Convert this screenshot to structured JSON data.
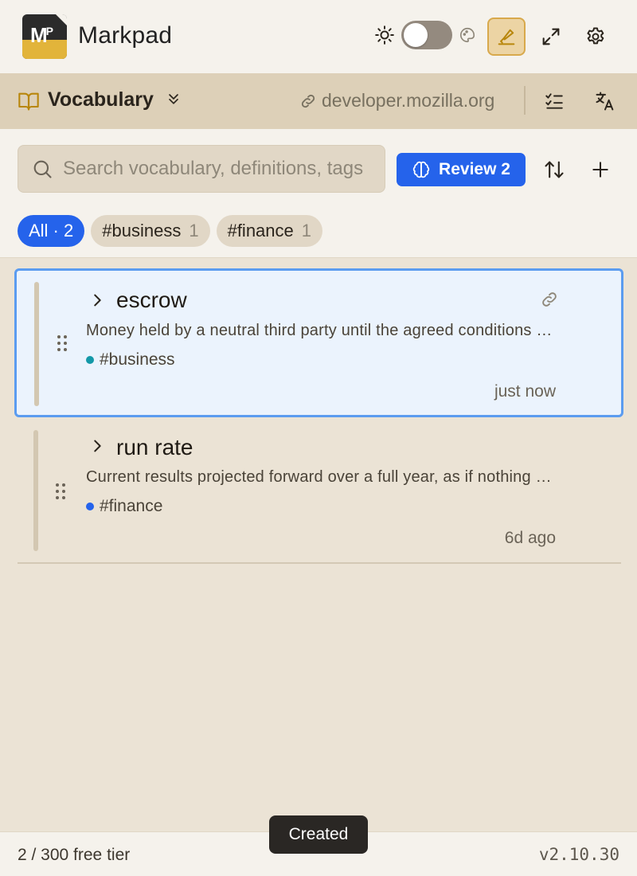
{
  "app": {
    "title": "Markpad",
    "logo_text": "MP"
  },
  "header": {
    "theme_toggle_state": "off",
    "icons": [
      "sun-icon",
      "palette-icon",
      "highlighter-icon",
      "expand-icon",
      "gear-icon"
    ]
  },
  "deck": {
    "name": "Vocabulary",
    "site": "developer.mozilla.org"
  },
  "search": {
    "placeholder": "Search vocabulary, definitions, tags",
    "value": ""
  },
  "toolbar": {
    "review_label": "Review 2"
  },
  "filters": [
    {
      "label": "All · 2",
      "count": "",
      "active": true
    },
    {
      "label": "#business",
      "count": "1",
      "active": false
    },
    {
      "label": "#finance",
      "count": "1",
      "active": false
    }
  ],
  "cards": [
    {
      "term": "escrow",
      "definition": "Money held by a neutral third party until the agreed conditions are met.",
      "tag": "#business",
      "tag_color": "#1398a8",
      "time": "just now",
      "selected": true
    },
    {
      "term": "run rate",
      "definition": "Current results projected forward over a full year, as if nothing changes.",
      "tag": "#finance",
      "tag_color": "#2563eb",
      "time": "6d ago",
      "selected": false
    }
  ],
  "footer": {
    "tier": "2 / 300 free tier",
    "version": "v2.10.30"
  },
  "toast": {
    "message": "Created"
  },
  "colors": {
    "accent": "#2563eb",
    "highlight_bg": "#ecd4a4",
    "deck_bar": "#ddd0b8",
    "surface": "#f5f2ec",
    "canvas": "#ebe3d5"
  }
}
